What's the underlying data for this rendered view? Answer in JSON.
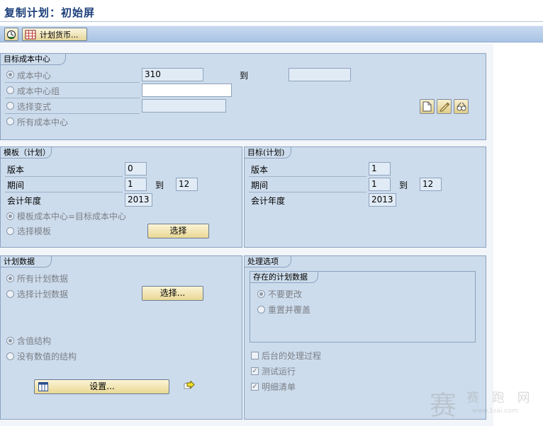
{
  "window": {
    "title": "复制计划：初始屏"
  },
  "toolbar": {
    "plan_currency_label": "计划货币..."
  },
  "target_cost_center": {
    "group_title": "目标成本中心",
    "options": [
      {
        "label": "成本中心",
        "checked": true
      },
      {
        "label": "成本中心组",
        "checked": false
      },
      {
        "label": "选择变式",
        "checked": false
      },
      {
        "label": "所有成本中心",
        "checked": false
      }
    ],
    "cost_center_value": "310",
    "to_label": "到",
    "to_value": ""
  },
  "template_plan": {
    "group_title": "模板（计划）",
    "version_label": "版本",
    "version_value": "0",
    "period_label": "期间",
    "period_from": "1",
    "to_label": "到",
    "period_to": "12",
    "fiscal_year_label": "会计年度",
    "fiscal_year_value": "2013",
    "radio_same_label": "模板成本中心=目标成本中心",
    "radio_select_label": "选择模板",
    "select_button": "选择"
  },
  "target_plan": {
    "group_title": "目标(计划)",
    "version_label": "版本",
    "version_value": "1",
    "period_label": "期间",
    "period_from": "1",
    "to_label": "到",
    "period_to": "12",
    "fiscal_year_label": "会计年度",
    "fiscal_year_value": "2013"
  },
  "plan_data": {
    "group_title": "计划数据",
    "all_label": "所有计划数据",
    "select_label": "选择计划数据",
    "select_button": "选择...",
    "with_values_label": "含值结构",
    "without_values_label": "没有数值的结构",
    "settings_button": "设置..."
  },
  "processing_options": {
    "group_title": "处理选项",
    "existing_title": "存在的计划数据",
    "no_change_label": "不要更改",
    "reset_overwrite_label": "重置并覆盖",
    "background_label": "后台的处理过程",
    "test_run_label": "测试运行",
    "detail_list_label": "明细清单"
  },
  "watermark": {
    "big": "赛",
    "word": "赛 跑 网",
    "url": "www.1sai.com"
  }
}
